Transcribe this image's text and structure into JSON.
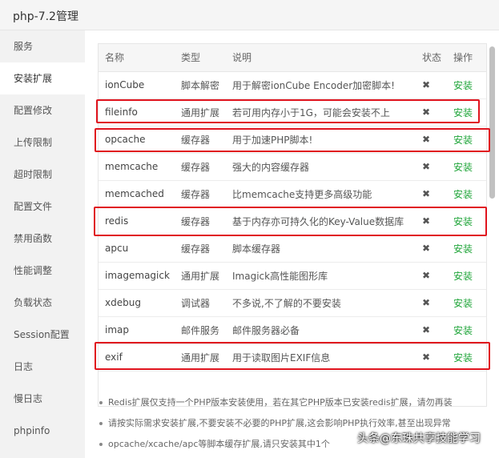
{
  "window": {
    "title": "php-7.2管理"
  },
  "sidebar": {
    "items": [
      {
        "label": "服务"
      },
      {
        "label": "安装扩展"
      },
      {
        "label": "配置修改"
      },
      {
        "label": "上传限制"
      },
      {
        "label": "超时限制"
      },
      {
        "label": "配置文件"
      },
      {
        "label": "禁用函数"
      },
      {
        "label": "性能调整"
      },
      {
        "label": "负载状态"
      },
      {
        "label": "Session配置"
      },
      {
        "label": "日志"
      },
      {
        "label": "慢日志"
      },
      {
        "label": "phpinfo"
      }
    ],
    "active_index": 1
  },
  "table": {
    "headers": {
      "name": "名称",
      "type": "类型",
      "desc": "说明",
      "status": "状态",
      "op": "操作"
    },
    "rows": [
      {
        "name": "ionCube",
        "type": "脚本解密",
        "desc": "用于解密ionCube Encoder加密脚本!",
        "status": "✖",
        "op": "安装"
      },
      {
        "name": "fileinfo",
        "type": "通用扩展",
        "desc": "若可用内存小于1G，可能会安装不上",
        "status": "✖",
        "op": "安装"
      },
      {
        "name": "opcache",
        "type": "缓存器",
        "desc": "用于加速PHP脚本!",
        "status": "✖",
        "op": "安装"
      },
      {
        "name": "memcache",
        "type": "缓存器",
        "desc": "强大的内容缓存器",
        "status": "✖",
        "op": "安装"
      },
      {
        "name": "memcached",
        "type": "缓存器",
        "desc": "比memcache支持更多高级功能",
        "status": "✖",
        "op": "安装"
      },
      {
        "name": "redis",
        "type": "缓存器",
        "desc": "基于内存亦可持久化的Key-Value数据库",
        "status": "✖",
        "op": "安装"
      },
      {
        "name": "apcu",
        "type": "缓存器",
        "desc": "脚本缓存器",
        "status": "✖",
        "op": "安装"
      },
      {
        "name": "imagemagick",
        "type": "通用扩展",
        "desc": "Imagick高性能图形库",
        "status": "✖",
        "op": "安装"
      },
      {
        "name": "xdebug",
        "type": "调试器",
        "desc": "不多说,不了解的不要安装",
        "status": "✖",
        "op": "安装"
      },
      {
        "name": "imap",
        "type": "邮件服务",
        "desc": "邮件服务器必备",
        "status": "✖",
        "op": "安装"
      },
      {
        "name": "exif",
        "type": "通用扩展",
        "desc": "用于读取图片EXIF信息",
        "status": "✖",
        "op": "安装"
      }
    ]
  },
  "notes": [
    "Redis扩展仅支持一个PHP版本安装使用，若在其它PHP版本已安装redis扩展，请勿再装",
    "请按实际需求安装扩展,不要安装不必要的PHP扩展,这会影响PHP执行效率,甚至出现异常",
    "opcache/xcache/apc等脚本缓存扩展,请只安装其中1个"
  ],
  "watermark": "头条@东珠共享技能学习",
  "colors": {
    "install_link": "#20a53a",
    "highlight_box": "#e0141e",
    "sidebar_bg": "#f2f2f2"
  }
}
